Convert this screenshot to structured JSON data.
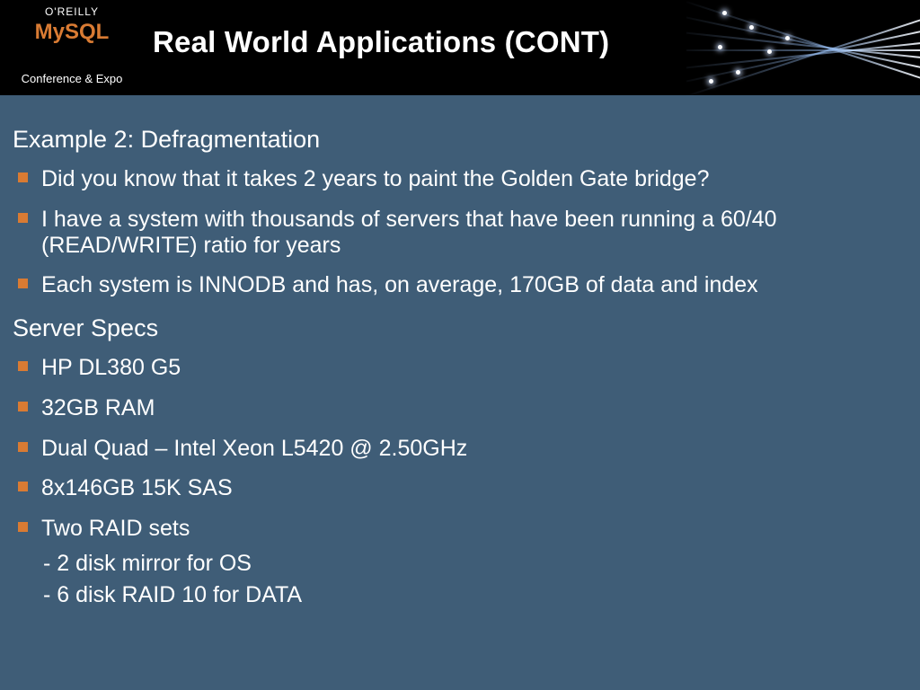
{
  "header": {
    "brand_top": "O'REILLY",
    "brand_main": "MySQL",
    "brand_sub": "Conference & Expo",
    "title": "Real World Applications (CONT)"
  },
  "section1": {
    "heading": "Example 2: Defragmentation",
    "bullets": [
      "Did you know that it takes 2 years to paint the Golden Gate bridge?",
      "I have a system with thousands of servers that have been running a 60/40 (READ/WRITE) ratio for years",
      "Each system is INNODB and has, on average, 170GB of data and index"
    ]
  },
  "section2": {
    "heading": "Server Specs",
    "bullets": [
      "HP DL380 G5",
      "32GB RAM",
      "Dual Quad – Intel Xeon L5420 @ 2.50GHz",
      "8x146GB 15K SAS",
      "Two RAID sets"
    ],
    "sublines": [
      "- 2 disk mirror for OS",
      "- 6 disk RAID 10 for DATA"
    ]
  }
}
